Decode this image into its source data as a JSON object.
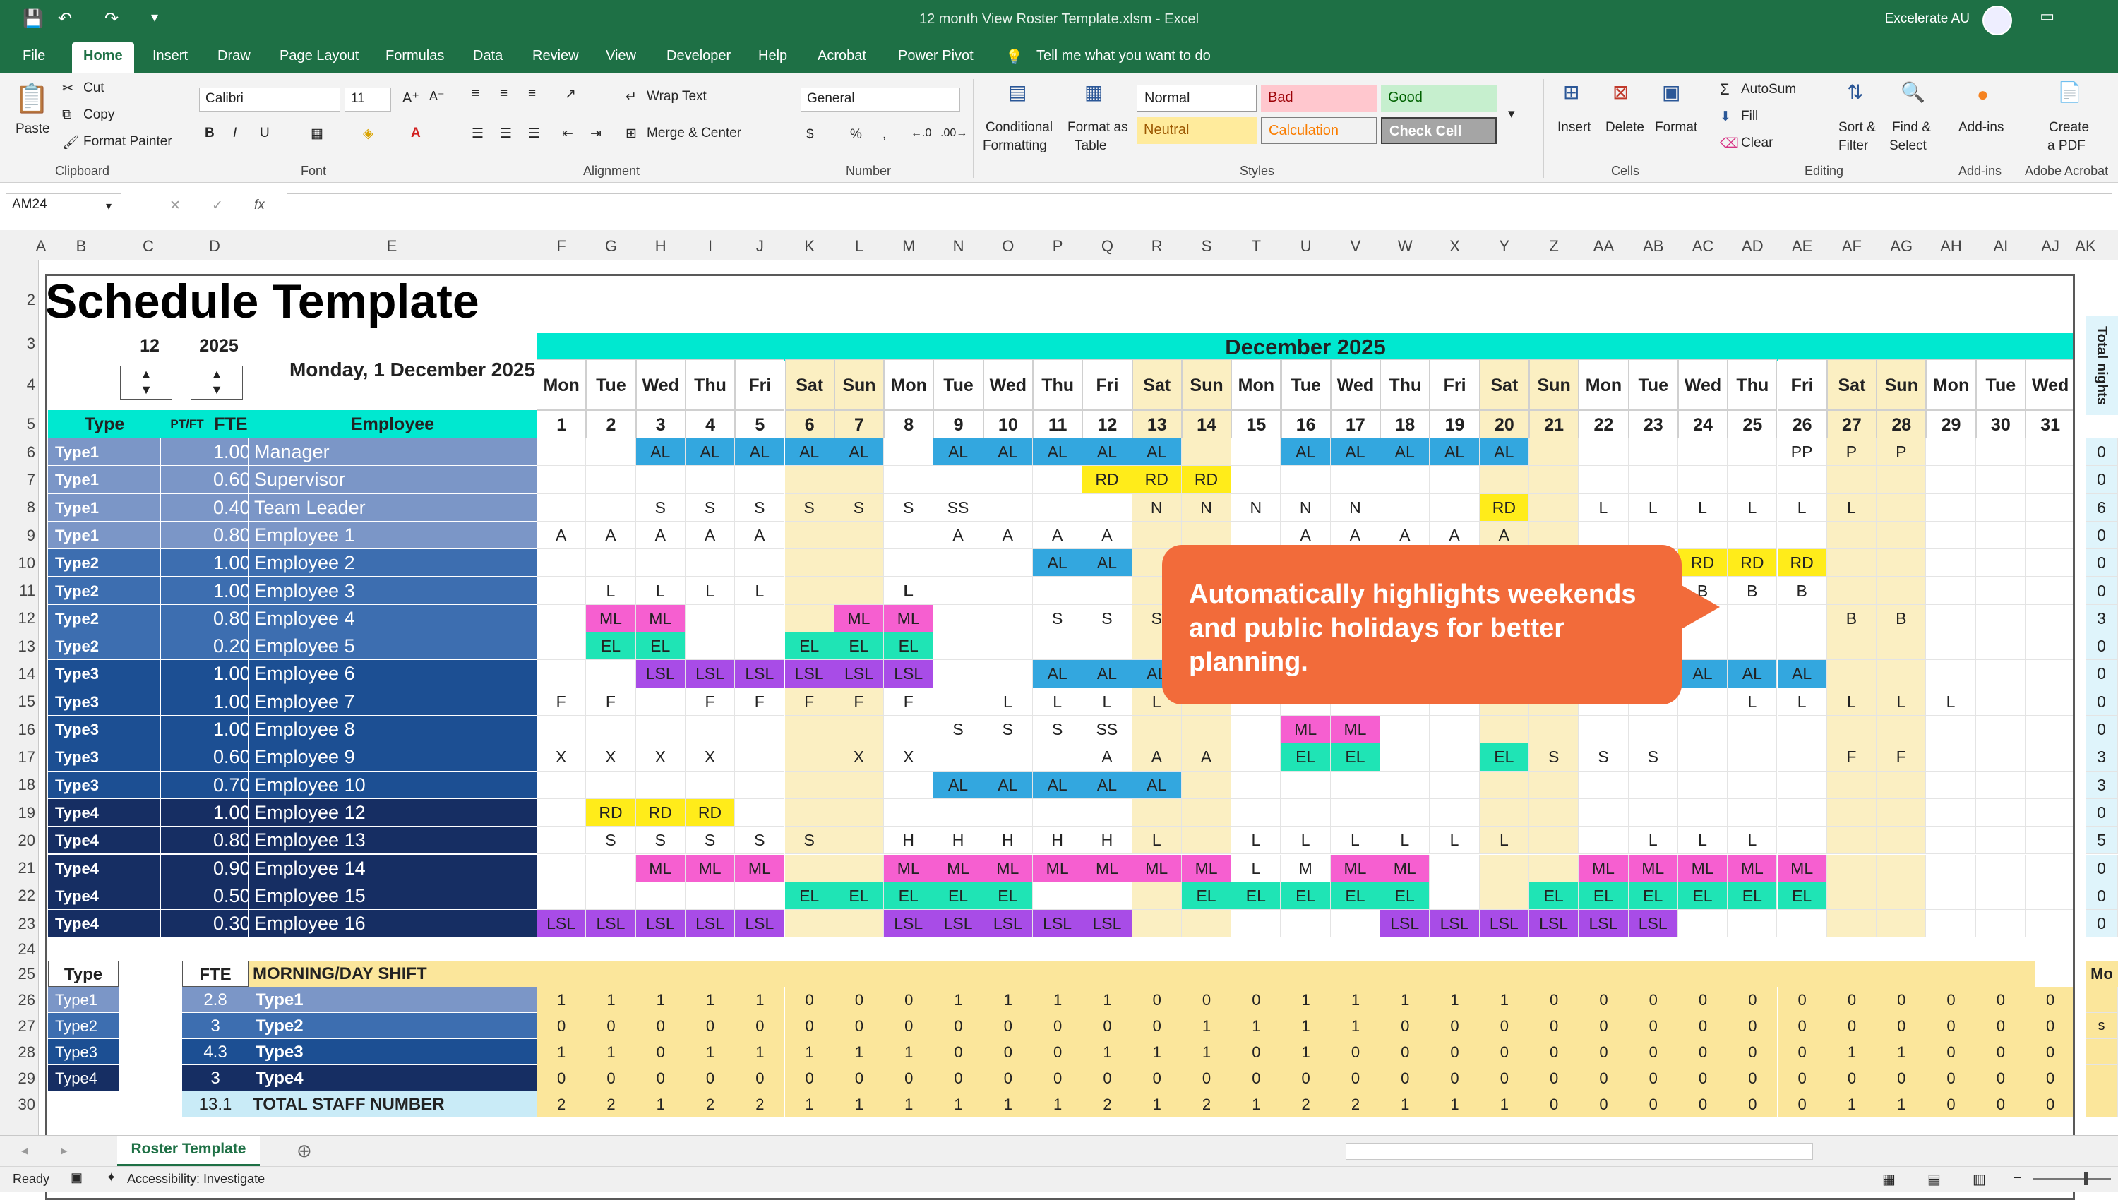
{
  "window": {
    "title": "12 month View Roster Template.xlsm - Excel",
    "account": "Excelerate AU"
  },
  "ribbon_tabs": [
    "File",
    "Home",
    "Insert",
    "Draw",
    "Page Layout",
    "Formulas",
    "Data",
    "Review",
    "View",
    "Developer",
    "Help",
    "Acrobat",
    "Power Pivot"
  ],
  "tell_me": "Tell me what you want to do",
  "ribbon": {
    "clipboard": {
      "paste": "Paste",
      "cut": "Cut",
      "copy": "Copy",
      "format_painter": "Format Painter",
      "group": "Clipboard"
    },
    "font": {
      "name": "Calibri",
      "size": "11",
      "group": "Font"
    },
    "alignment": {
      "wrap": "Wrap Text",
      "merge": "Merge & Center",
      "group": "Alignment"
    },
    "number": {
      "format": "General",
      "group": "Number"
    },
    "styles": {
      "conditional": "Conditional",
      "conditional2": "Formatting",
      "format_table": "Format as",
      "format_table2": "Table",
      "normal": "Normal",
      "bad": "Bad",
      "good": "Good",
      "neutral": "Neutral",
      "calculation": "Calculation",
      "check": "Check Cell",
      "group": "Styles"
    },
    "cells": {
      "insert": "Insert",
      "delete": "Delete",
      "format": "Format",
      "group": "Cells"
    },
    "editing": {
      "autosum": "AutoSum",
      "fill": "Fill",
      "clear": "Clear",
      "sort": "Sort &",
      "sort2": "Filter",
      "find": "Find &",
      "find2": "Select",
      "group": "Editing"
    },
    "addins": {
      "label": "Add-ins",
      "group": "Add-ins"
    },
    "acrobat": {
      "create": "Create",
      "create2": "a PDF",
      "group": "Adobe Acrobat"
    }
  },
  "formula_bar": {
    "name_box": "AM24",
    "formula": ""
  },
  "columns": [
    "A",
    "B",
    "C",
    "D",
    "E",
    "F",
    "G",
    "H",
    "I",
    "J",
    "K",
    "L",
    "M",
    "N",
    "O",
    "P",
    "Q",
    "R",
    "S",
    "T",
    "U",
    "V",
    "W",
    "X",
    "Y",
    "Z",
    "AA",
    "AB",
    "AC",
    "AD",
    "AE",
    "AF",
    "AG",
    "AH",
    "AI",
    "AJ",
    "AK"
  ],
  "rows": [
    "2",
    "3",
    "4",
    "5",
    "6",
    "7",
    "8",
    "9",
    "10",
    "11",
    "12",
    "13",
    "14",
    "15",
    "16",
    "17",
    "18",
    "19",
    "20",
    "21",
    "22",
    "23",
    "24",
    "25",
    "26",
    "27",
    "28",
    "29",
    "30"
  ],
  "schedule": {
    "title": "Schedule Template",
    "month_num": "12",
    "year": "2025",
    "date_text": "Monday, 1 December 2025",
    "month_header": "December 2025",
    "total_nights_label": "Total nights",
    "headers": {
      "type": "Type",
      "ptft": "PT/FT",
      "fte": "FTE",
      "employee": "Employee"
    },
    "weekdays": [
      "Mon",
      "Tue",
      "Wed",
      "Thu",
      "Fri",
      "Sat",
      "Sun",
      "Mon",
      "Tue",
      "Wed",
      "Thu",
      "Fri",
      "Sat",
      "Sun",
      "Mon",
      "Tue",
      "Wed",
      "Thu",
      "Fri",
      "Sat",
      "Sun",
      "Mon",
      "Tue",
      "Wed",
      "Thu",
      "Fri",
      "Sat",
      "Sun",
      "Mon",
      "Tue",
      "Wed"
    ],
    "days": [
      "1",
      "2",
      "3",
      "4",
      "5",
      "6",
      "7",
      "8",
      "9",
      "10",
      "11",
      "12",
      "13",
      "14",
      "15",
      "16",
      "17",
      "18",
      "19",
      "20",
      "21",
      "22",
      "23",
      "24",
      "25",
      "26",
      "27",
      "28",
      "29",
      "30",
      "31"
    ],
    "weekend_index": [
      5,
      6,
      12,
      13,
      19,
      20,
      26,
      27
    ],
    "employees": [
      {
        "type": "Type1",
        "fte": "1.00",
        "name": "Manager",
        "shifts": [
          "",
          "",
          "AL",
          "AL",
          "AL",
          "AL",
          "AL",
          "",
          "AL",
          "AL",
          "AL",
          "AL",
          "AL",
          "",
          "",
          "AL",
          "AL",
          "AL",
          "AL",
          "AL",
          "",
          "",
          "",
          "",
          "",
          "PP",
          "P",
          "P",
          "",
          "",
          ""
        ],
        "total": "0"
      },
      {
        "type": "Type1",
        "fte": "0.60",
        "name": "Supervisor",
        "shifts": [
          "",
          "",
          "",
          "",
          "",
          "",
          "",
          "",
          "",
          "",
          "",
          "RD",
          "RD",
          "RD",
          "",
          "",
          "",
          "",
          "",
          "",
          "",
          "",
          "",
          "",
          "",
          "",
          "",
          "",
          "",
          "",
          ""
        ],
        "total": "0"
      },
      {
        "type": "Type1",
        "fte": "0.40",
        "name": "Team Leader",
        "shifts": [
          "",
          "",
          "S",
          "S",
          "S",
          "S",
          "S",
          "S",
          "SS",
          "",
          "",
          "",
          "N",
          "N",
          "N",
          "N",
          "N",
          "",
          "",
          "RD",
          "",
          "L",
          "L",
          "L",
          "L",
          "L",
          "L",
          "",
          "",
          "",
          ""
        ],
        "total": "6"
      },
      {
        "type": "Type1",
        "fte": "0.80",
        "name": "Employee 1",
        "shifts": [
          "A",
          "A",
          "A",
          "A",
          "A",
          "",
          "",
          "",
          "A",
          "A",
          "A",
          "A",
          "",
          "",
          "",
          "A",
          "A",
          "A",
          "A",
          "A",
          "",
          "",
          "",
          "",
          "",
          "",
          "",
          "",
          "",
          "",
          ""
        ],
        "total": "0"
      },
      {
        "type": "Type2",
        "fte": "1.00",
        "name": "Employee 2",
        "shifts": [
          "",
          "",
          "",
          "",
          "",
          "",
          "",
          "",
          "",
          "",
          "AL",
          "AL",
          "",
          "",
          "",
          "",
          "",
          "",
          "",
          "",
          "",
          "",
          "",
          "RD",
          "RD",
          "RD",
          "",
          "",
          "",
          "",
          ""
        ],
        "total": "0"
      },
      {
        "type": "Type2",
        "fte": "1.00",
        "name": "Employee 3",
        "shifts": [
          "",
          "L",
          "L",
          "L",
          "L",
          "",
          "",
          "L",
          "",
          "",
          "",
          "",
          "",
          "",
          "",
          "",
          "",
          "",
          "",
          "",
          "",
          "",
          "",
          "B",
          "B",
          "B",
          "",
          "",
          "",
          "",
          ""
        ],
        "total": "0"
      },
      {
        "type": "Type2",
        "fte": "0.80",
        "name": "Employee 4",
        "shifts": [
          "",
          "ML",
          "ML",
          "",
          "",
          "",
          "ML",
          "ML",
          "",
          "",
          "S",
          "S",
          "S",
          "",
          "",
          "",
          "",
          "",
          "",
          "",
          "",
          "",
          "",
          "",
          "",
          "",
          "B",
          "B",
          "",
          "",
          ""
        ],
        "total": "3"
      },
      {
        "type": "Type2",
        "fte": "0.20",
        "name": "Employee 5",
        "shifts": [
          "",
          "EL",
          "EL",
          "",
          "",
          "EL",
          "EL",
          "EL",
          "",
          "",
          "",
          "",
          "",
          "",
          "",
          "",
          "",
          "",
          "",
          "",
          "",
          "",
          "",
          "",
          "",
          "",
          "",
          "",
          "",
          "",
          ""
        ],
        "total": "0"
      },
      {
        "type": "Type3",
        "fte": "1.00",
        "name": "Employee 6",
        "shifts": [
          "",
          "",
          "LSL",
          "LSL",
          "LSL",
          "LSL",
          "LSL",
          "LSL",
          "",
          "",
          "AL",
          "AL",
          "AL",
          "",
          "",
          "",
          "",
          "",
          "",
          "",
          "",
          "",
          "",
          "AL",
          "AL",
          "AL",
          "",
          "",
          "",
          "",
          ""
        ],
        "total": "0"
      },
      {
        "type": "Type3",
        "fte": "1.00",
        "name": "Employee 7",
        "shifts": [
          "F",
          "F",
          "",
          "F",
          "F",
          "F",
          "F",
          "F",
          "",
          "L",
          "L",
          "L",
          "L",
          "",
          "",
          "",
          "",
          "",
          "",
          "",
          "",
          "",
          "",
          "",
          "L",
          "L",
          "L",
          "L",
          "L",
          "",
          ""
        ],
        "total": "0"
      },
      {
        "type": "Type3",
        "fte": "1.00",
        "name": "Employee 8",
        "shifts": [
          "",
          "",
          "",
          "",
          "",
          "",
          "",
          "",
          "S",
          "S",
          "S",
          "SS",
          "",
          "",
          "",
          "ML",
          "ML",
          "",
          "",
          "",
          "",
          "",
          "",
          "",
          "",
          "",
          "",
          "",
          "",
          "",
          ""
        ],
        "total": "0"
      },
      {
        "type": "Type3",
        "fte": "0.60",
        "name": "Employee 9",
        "shifts": [
          "X",
          "X",
          "X",
          "X",
          "",
          "",
          "X",
          "X",
          "",
          "",
          "",
          "A",
          "A",
          "A",
          "",
          "EL",
          "EL",
          "",
          "",
          "EL",
          "S",
          "S",
          "S",
          "",
          "",
          "",
          "F",
          "F",
          "",
          "",
          ""
        ],
        "total": "3"
      },
      {
        "type": "Type3",
        "fte": "0.70",
        "name": "Employee 10",
        "shifts": [
          "",
          "",
          "",
          "",
          "",
          "",
          "",
          "",
          "AL",
          "AL",
          "AL",
          "AL",
          "AL",
          "",
          "",
          "",
          "",
          "",
          "",
          "",
          "",
          "",
          "",
          "",
          "",
          "",
          "",
          "",
          "",
          "",
          ""
        ],
        "total": "3"
      },
      {
        "type": "Type4",
        "fte": "1.00",
        "name": "Employee 12",
        "shifts": [
          "",
          "RD",
          "RD",
          "RD",
          "",
          "",
          "",
          "",
          "",
          "",
          "",
          "",
          "",
          "",
          "",
          "",
          "",
          "",
          "",
          "",
          "",
          "",
          "",
          "",
          "",
          "",
          "",
          "",
          "",
          "",
          ""
        ],
        "total": "0"
      },
      {
        "type": "Type4",
        "fte": "0.80",
        "name": "Employee 13",
        "shifts": [
          "",
          "S",
          "S",
          "S",
          "S",
          "S",
          "",
          "H",
          "H",
          "H",
          "H",
          "H",
          "L",
          "",
          "L",
          "L",
          "L",
          "L",
          "L",
          "L",
          "",
          "",
          "L",
          "L",
          "L",
          "",
          "",
          "",
          "",
          "",
          ""
        ],
        "total": "5"
      },
      {
        "type": "Type4",
        "fte": "0.90",
        "name": "Employee 14",
        "shifts": [
          "",
          "",
          "ML",
          "ML",
          "ML",
          "",
          "",
          "ML",
          "ML",
          "ML",
          "ML",
          "ML",
          "ML",
          "ML",
          "L",
          "M",
          "ML",
          "ML",
          "",
          "",
          "",
          "ML",
          "ML",
          "ML",
          "ML",
          "ML",
          "",
          "",
          "",
          "",
          ""
        ],
        "total": "0"
      },
      {
        "type": "Type4",
        "fte": "0.50",
        "name": "Employee 15",
        "shifts": [
          "",
          "",
          "",
          "",
          "",
          "EL",
          "EL",
          "EL",
          "EL",
          "EL",
          "",
          "",
          "",
          "EL",
          "EL",
          "EL",
          "EL",
          "EL",
          "",
          "",
          "EL",
          "EL",
          "EL",
          "EL",
          "EL",
          "EL",
          "",
          "",
          "",
          "",
          ""
        ],
        "total": "0"
      },
      {
        "type": "Type4",
        "fte": "0.30",
        "name": "Employee 16",
        "shifts": [
          "LSL",
          "LSL",
          "LSL",
          "LSL",
          "LSL",
          "",
          "",
          "LSL",
          "LSL",
          "LSL",
          "LSL",
          "LSL",
          "",
          "",
          "",
          "",
          "",
          "LSL",
          "LSL",
          "LSL",
          "LSL",
          "LSL",
          "LSL",
          "",
          "",
          "",
          "",
          "",
          "",
          "",
          ""
        ],
        "total": "0"
      }
    ],
    "summary": {
      "header_type": "Type",
      "header_fte": "FTE",
      "header_shift": "MORNING/DAY SHIFT",
      "right_label": "Mo",
      "rows": [
        {
          "type": "Type1",
          "fte": "2.8",
          "label": "Type1",
          "values": [
            "1",
            "1",
            "1",
            "1",
            "1",
            "0",
            "0",
            "0",
            "1",
            "1",
            "1",
            "1",
            "0",
            "0",
            "0",
            "1",
            "1",
            "1",
            "1",
            "1",
            "0",
            "0",
            "0",
            "0",
            "0",
            "0",
            "0",
            "0",
            "0",
            "0",
            "0"
          ],
          "right": ""
        },
        {
          "type": "Type2",
          "fte": "3",
          "label": "Type2",
          "values": [
            "0",
            "0",
            "0",
            "0",
            "0",
            "0",
            "0",
            "0",
            "0",
            "0",
            "0",
            "0",
            "0",
            "1",
            "1",
            "1",
            "1",
            "0",
            "0",
            "0",
            "0",
            "0",
            "0",
            "0",
            "0",
            "0",
            "0",
            "0",
            "0",
            "0",
            "0"
          ],
          "right": "s"
        },
        {
          "type": "Type3",
          "fte": "4.3",
          "label": "Type3",
          "values": [
            "1",
            "1",
            "0",
            "1",
            "1",
            "1",
            "1",
            "1",
            "0",
            "0",
            "0",
            "1",
            "1",
            "1",
            "0",
            "1",
            "0",
            "0",
            "0",
            "0",
            "0",
            "0",
            "0",
            "0",
            "0",
            "0",
            "1",
            "1",
            "0",
            "0",
            "0"
          ],
          "right": ""
        },
        {
          "type": "Type4",
          "fte": "3",
          "label": "Type4",
          "values": [
            "0",
            "0",
            "0",
            "0",
            "0",
            "0",
            "0",
            "0",
            "0",
            "0",
            "0",
            "0",
            "0",
            "0",
            "0",
            "0",
            "0",
            "0",
            "0",
            "0",
            "0",
            "0",
            "0",
            "0",
            "0",
            "0",
            "0",
            "0",
            "0",
            "0",
            "0"
          ],
          "right": ""
        }
      ],
      "total": {
        "fte": "13.1",
        "label": "TOTAL STAFF NUMBER",
        "values": [
          "2",
          "2",
          "1",
          "2",
          "2",
          "1",
          "1",
          "1",
          "1",
          "1",
          "1",
          "2",
          "1",
          "2",
          "1",
          "2",
          "2",
          "1",
          "1",
          "1",
          "0",
          "0",
          "0",
          "0",
          "0",
          "0",
          "1",
          "1",
          "0",
          "0",
          "0"
        ]
      }
    }
  },
  "callout": {
    "text": "Automatically highlights weekends and public holidays for better planning."
  },
  "sheet_tab": "Roster Template",
  "status": {
    "ready": "Ready",
    "accessibility": "Accessibility: Investigate"
  },
  "colors": {
    "excel_green": "#1e7045",
    "cyan_header": "#00e8d0",
    "weekend_yellow": "#fbefc2",
    "AL": "#33a7df",
    "RD": "#ffec1a",
    "ML": "#f65fd0",
    "EL": "#1fe4b5",
    "LSL": "#a84ce7",
    "type1": "#7b96c7",
    "type2": "#3d6eb0",
    "type3": "#1c4f93",
    "type4": "#162e63",
    "callout": "#f26b3a"
  }
}
